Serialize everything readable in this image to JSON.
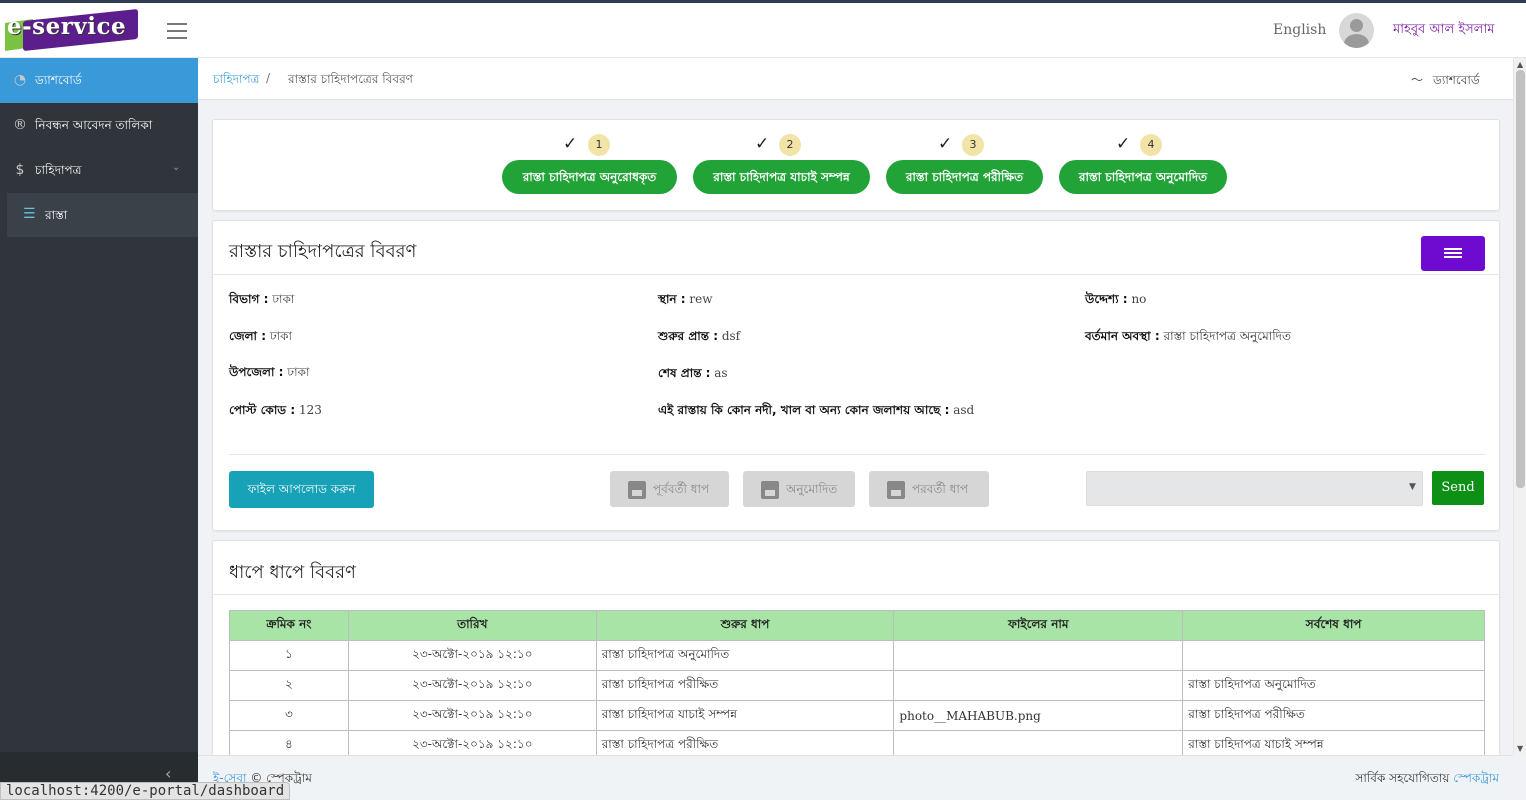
{
  "header": {
    "logo_text": "e-service",
    "language": "English",
    "username": "মাহবুব আল ইসলাম"
  },
  "sidebar": {
    "items": [
      {
        "label": "ড্যাশবোর্ড",
        "icon": "speedometer-icon",
        "active": true
      },
      {
        "label": "নিবন্ধন আবেদন তালিকা",
        "icon": "registered-icon",
        "active": false
      },
      {
        "label": "চাহিদাপত্র",
        "icon": "dollar-icon",
        "active": false
      },
      {
        "label": "রাস্তা",
        "icon": "list-icon",
        "active": false
      }
    ]
  },
  "breadcrumb": {
    "parent": "চাহিদাপত্র",
    "separator": "/",
    "current": "রাস্তার চাহিদাপত্রের বিবরণ",
    "right_link": "ড্যাশবোর্ড"
  },
  "steps": [
    {
      "num": "1",
      "label": "রাস্তা চাহিদাপত্র অনুরোধকৃত",
      "check": "✓"
    },
    {
      "num": "2",
      "label": "রাস্তা চাহিদাপত্র যাচাই সম্পন্ন",
      "check": "✓"
    },
    {
      "num": "3",
      "label": "রাস্তা চাহিদাপত্র পরীক্ষিত",
      "check": "✓"
    },
    {
      "num": "4",
      "label": "রাস্তা চাহিদাপত্র অনুমোদিত",
      "check": "✓"
    }
  ],
  "details": {
    "title": "রাস্তার চাহিদাপত্রের বিবরণ",
    "division": {
      "label": "বিভাগ :",
      "value": "ঢাকা"
    },
    "district": {
      "label": "জেলা :",
      "value": "ঢাকা"
    },
    "upazila": {
      "label": "উপজেলা :",
      "value": "ঢাকা"
    },
    "postcode": {
      "label": "পোস্ট কোড :",
      "value": "123"
    },
    "place": {
      "label": "স্থান :",
      "value": "rew"
    },
    "start_point": {
      "label": "শুরুর প্রান্ত :",
      "value": "dsf"
    },
    "end_point": {
      "label": "শেষ প্রান্ত :",
      "value": "as"
    },
    "waterbody": {
      "label": "এই রাস্তায় কি কোন নদী, খাল বা অন্য কোন জলাশয় আছে :",
      "value": "asd"
    },
    "purpose": {
      "label": "উদ্দেশ্য :",
      "value": "no"
    },
    "status": {
      "label": "বর্তমান অবস্থা :",
      "value": "রাস্তা চাহিদাপত্র অনুমোদিত"
    }
  },
  "actions": {
    "upload": "ফাইল আপলোড করুন",
    "previous": "পূর্ববর্তী ধাপ",
    "approved": "অনুমোদিত",
    "next": "পরবর্তী ধাপ",
    "select_value": "",
    "send": "Send"
  },
  "history": {
    "title": "ধাপে ধাপে বিবরণ",
    "columns": [
      "ক্রমিক নং",
      "তারিখ",
      "শুরুর ধাপ",
      "ফাইলের নাম",
      "সর্বশেষ ধাপ"
    ],
    "rows": [
      {
        "serial": "১",
        "date": "২৩-অক্টো-২০১৯ ১২:১০",
        "start": "রাস্তা চাহিদাপত্র অনুমোদিত",
        "file": "",
        "last": ""
      },
      {
        "serial": "২",
        "date": "২৩-অক্টো-২০১৯ ১২:১০",
        "start": "রাস্তা চাহিদাপত্র পরীক্ষিত",
        "file": "",
        "last": "রাস্তা চাহিদাপত্র অনুমোদিত"
      },
      {
        "serial": "৩",
        "date": "২৩-অক্টো-২০১৯ ১২:১০",
        "start": "রাস্তা চাহিদাপত্র যাচাই সম্পন্ন",
        "file": "photo__MAHABUB.png",
        "last": "রাস্তা চাহিদাপত্র পরীক্ষিত"
      },
      {
        "serial": "৪",
        "date": "২৩-অক্টো-২০১৯ ১২:১০",
        "start": "রাস্তা চাহিদাপত্র পরীক্ষিত",
        "file": "",
        "last": "রাস্তা চাহিদাপত্র যাচাই সম্পন্ন"
      }
    ]
  },
  "footer": {
    "left_link": "ই-সেবা",
    "left_text": "© স্পেকট্রাম",
    "right_text": "সার্বিক সহযোগিতায়",
    "right_link": "স্পেকট্রাম"
  },
  "status_url": "localhost:4200/e-portal/dashboard",
  "colors": {
    "accent": "#3a9ad9",
    "step_green": "#21a337",
    "purple": "#6f0bd1",
    "table_header": "#a8e4a6"
  }
}
